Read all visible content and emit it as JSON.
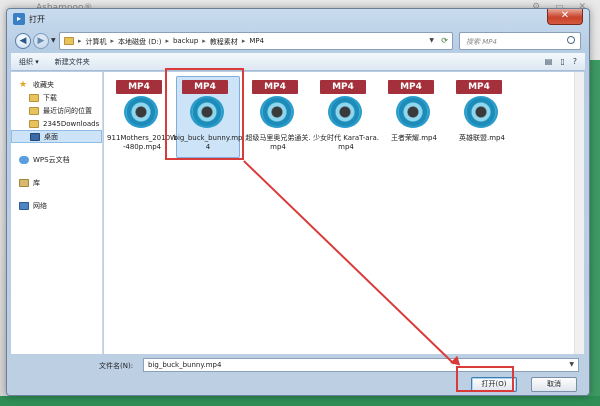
{
  "background_app": {
    "title": "Ashampoo®"
  },
  "dialog": {
    "title": "打开",
    "close_label": "✕"
  },
  "address": {
    "crumbs": [
      "计算机",
      "本地磁盘 (D:)",
      "backup",
      "教程素材",
      "MP4"
    ],
    "search_placeholder": "搜索 MP4"
  },
  "toolbar": {
    "organize": "组织 ▾",
    "new_folder": "新建文件夹"
  },
  "sidebar": {
    "favorites": {
      "label": "收藏夹",
      "items": [
        {
          "label": "下载"
        },
        {
          "label": "最近访问的位置"
        },
        {
          "label": "2345Downloads"
        },
        {
          "label": "桌面"
        }
      ]
    },
    "cloud": "WPS云文档",
    "library": "库",
    "network": "网络"
  },
  "files": [
    {
      "badge": "MP4",
      "name": "911Mothers_2010W-480p.mp4",
      "selected": false
    },
    {
      "badge": "MP4",
      "name": "big_buck_bunny.mp4",
      "selected": true
    },
    {
      "badge": "MP4",
      "name": "超级马里奥兄弟通关.mp4",
      "selected": false
    },
    {
      "badge": "MP4",
      "name": "少女时代 KaraT-ara.mp4",
      "selected": false
    },
    {
      "badge": "MP4",
      "name": "王者荣耀.mp4",
      "selected": false
    },
    {
      "badge": "MP4",
      "name": "英雄联盟.mp4",
      "selected": false
    }
  ],
  "footer": {
    "filename_label": "文件名(N):",
    "filename_value": "big_buck_bunny.mp4",
    "open_label": "打开(O)",
    "cancel_label": "取消"
  },
  "colors": {
    "annotation": "#d93a3a",
    "badge": "#a3303b",
    "selection": "#cde3f7"
  }
}
